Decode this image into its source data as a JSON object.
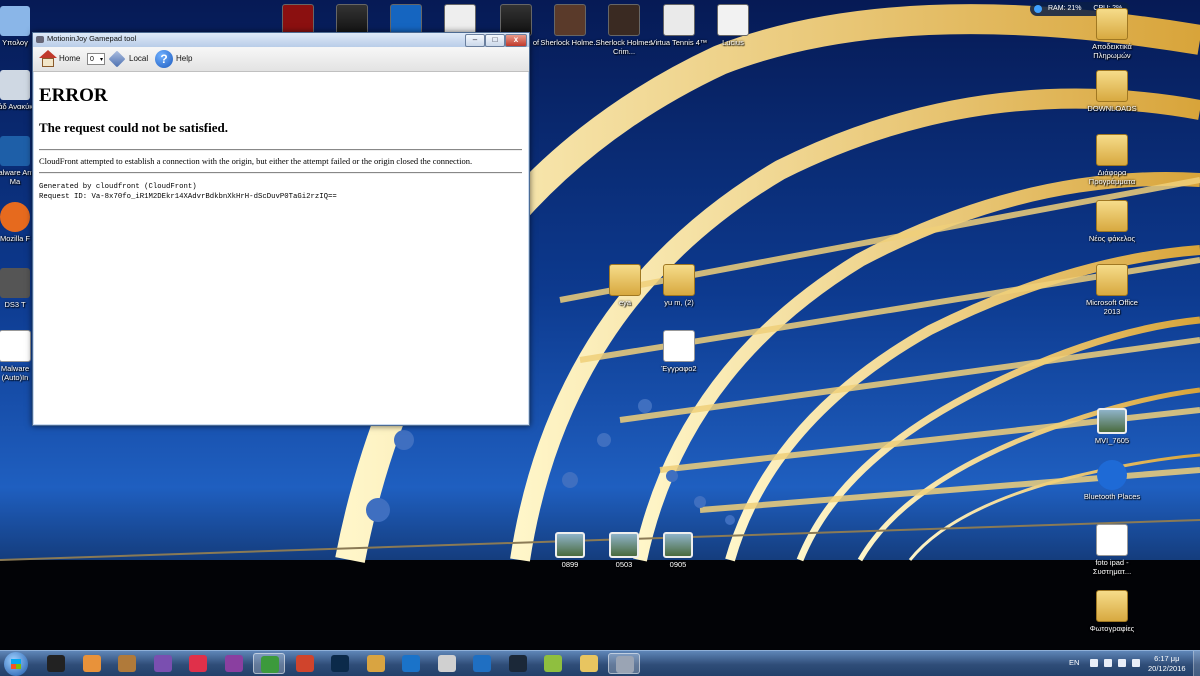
{
  "desktop": {
    "icons_top": [
      {
        "label": "",
        "kind": "game"
      },
      {
        "label": "",
        "kind": "game"
      },
      {
        "label": "",
        "kind": "game"
      },
      {
        "label": "",
        "kind": "game"
      },
      {
        "label": "of",
        "kind": "game"
      },
      {
        "label": "Sherlock Holme...",
        "kind": "game"
      },
      {
        "label": "Sherlock Holmes Crim...",
        "kind": "game"
      },
      {
        "label": "Virtua Tennis 4™",
        "kind": "game"
      },
      {
        "label": "Lucius",
        "kind": "game"
      }
    ],
    "icons_left": [
      "Υπολογ",
      "Κάδ Ανακύκλ",
      "Malware Anti-Ma",
      "Mozilla F",
      "DS3 T",
      "Malware (Auto)In"
    ],
    "icons_right": [
      "Αποδεικτικά Πληρωμών",
      "DOWNLOADS",
      "Διάφορα Προγράμματα",
      "Νέος φάκελος",
      "Microsoft Office 2013",
      "MVI_7605",
      "Bluetooth Places",
      "foto ipad - Συστηματ...",
      "Φωτογραφίες"
    ],
    "icons_middle": [
      "eya",
      "yu m, (2)",
      "Έγγραφο2",
      "0899",
      "0503",
      "0905"
    ],
    "meter": {
      "ram": "RAM: 21%",
      "cpu": "CPU: 2%"
    }
  },
  "window": {
    "title": "MotioninJoy Gamepad tool",
    "controls": {
      "minimize": "–",
      "maximize": "□",
      "close": "x"
    },
    "toolbar": {
      "home_label": "Home",
      "select_value": "0",
      "local_label": "Local",
      "help_label": "Help"
    },
    "page": {
      "heading": "ERROR",
      "subheading": "The request could not be satisfied.",
      "message": "CloudFront attempted to establish a connection with the origin, but either the attempt failed or the origin closed the connection.",
      "generated_by": "Generated by cloudfront (CloudFront)",
      "request_id": "Request ID: Va-8x70fo_iR1M2DEkr14XAdvrBdkbnXkHrH-dScDuvP0TaGi2rzIQ=="
    }
  },
  "taskbar": {
    "lang": "EN",
    "time": "6:17 μμ",
    "date": "20/12/2016",
    "items": [
      {
        "name": "rp",
        "color": "#222222"
      },
      {
        "name": "media",
        "color": "#e8923a"
      },
      {
        "name": "library",
        "color": "#b07a3a"
      },
      {
        "name": "visualstudio",
        "color": "#7a4fb0"
      },
      {
        "name": "itunes",
        "color": "#e0304a"
      },
      {
        "name": "epub",
        "color": "#8a3fa0"
      },
      {
        "name": "utorrent",
        "color": "#3c9a3c"
      },
      {
        "name": "ccleaner",
        "color": "#d0442c"
      },
      {
        "name": "photoshop",
        "color": "#0b2a4a"
      },
      {
        "name": "files",
        "color": "#d9a441"
      },
      {
        "name": "update",
        "color": "#1a73c9"
      },
      {
        "name": "calendar",
        "color": "#d0d0d0"
      },
      {
        "name": "teamviewer",
        "color": "#1f6fc2"
      },
      {
        "name": "steam",
        "color": "#1b2838"
      },
      {
        "name": "music",
        "color": "#8fbf3f"
      },
      {
        "name": "explorer",
        "color": "#e8c560"
      },
      {
        "name": "gamepad",
        "color": "#9aa4b4"
      }
    ]
  }
}
